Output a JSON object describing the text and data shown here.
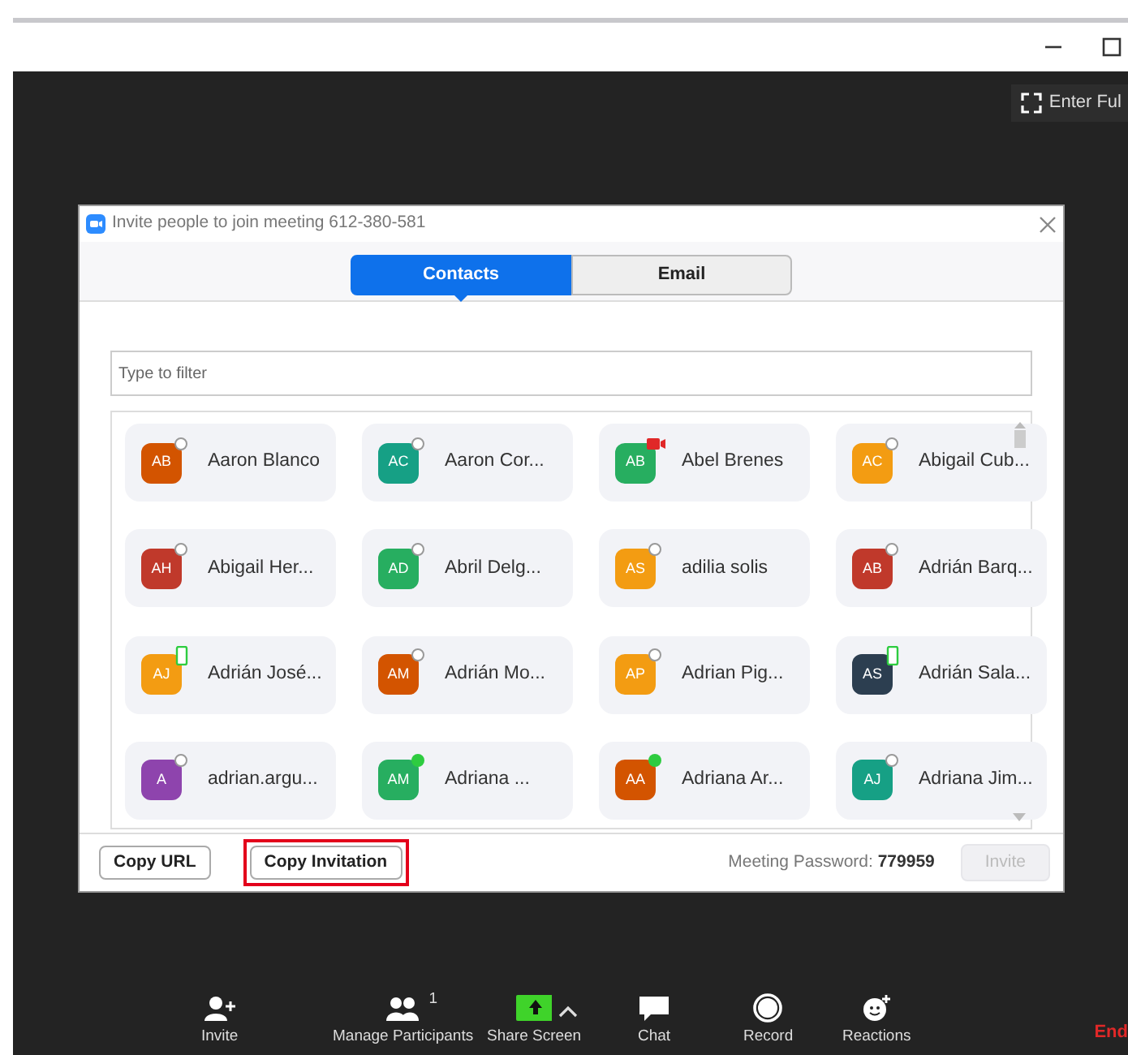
{
  "fullscreen_button": {
    "label": "Enter Ful"
  },
  "dialog": {
    "title": "Invite people to join meeting 612-380-581",
    "tabs": [
      {
        "label": "Contacts",
        "selected": true
      },
      {
        "label": "Email",
        "selected": false
      }
    ],
    "filter": {
      "placeholder": "Type to filter"
    },
    "contacts": [
      {
        "initials": "AB",
        "name": "Aaron Blanco",
        "color": "#d35400",
        "kind": "offline"
      },
      {
        "initials": "AC",
        "name": "Aaron Cor...",
        "color": "#16a085",
        "kind": "offline"
      },
      {
        "initials": "AB",
        "name": "Abel Brenes",
        "color": "#27ae60",
        "kind": "meeting"
      },
      {
        "initials": "AC",
        "name": "Abigail Cub...",
        "color": "#f39c12",
        "kind": "offline"
      },
      {
        "initials": "AH",
        "name": "Abigail Her...",
        "color": "#c0392b",
        "kind": "offline"
      },
      {
        "initials": "AD",
        "name": "Abril Delg...",
        "color": "#27ae60",
        "kind": "offline"
      },
      {
        "initials": "AS",
        "name": "adilia solis",
        "color": "#f39c12",
        "kind": "offline"
      },
      {
        "initials": "AB",
        "name": "Adrián Barq...",
        "color": "#c0392b",
        "kind": "offline"
      },
      {
        "initials": "AJ",
        "name": "Adrián José...",
        "color": "#f39c12",
        "kind": "phone"
      },
      {
        "initials": "AM",
        "name": "Adrián Mo...",
        "color": "#d35400",
        "kind": "offline"
      },
      {
        "initials": "AP",
        "name": "Adrian Pig...",
        "color": "#f39c12",
        "kind": "offline"
      },
      {
        "initials": "AS",
        "name": "Adrián Sala...",
        "color": "#2c3e50",
        "kind": "phone"
      },
      {
        "initials": "A",
        "name": "adrian.argu...",
        "color": "#8e44ad",
        "kind": "offline"
      },
      {
        "initials": "AM",
        "name": "Adriana ...",
        "color": "#27ae60",
        "kind": "online"
      },
      {
        "initials": "AA",
        "name": "Adriana Ar...",
        "color": "#d35400",
        "kind": "online"
      },
      {
        "initials": "AJ",
        "name": "Adriana Jim...",
        "color": "#16a085",
        "kind": "offline"
      }
    ],
    "buttons": [
      {
        "label": "Copy URL",
        "highlighted": false
      },
      {
        "label": "Copy Invitation",
        "highlighted": true
      }
    ],
    "password_label": "Meeting Password:",
    "password": "779959",
    "invite_button": {
      "label": "Invite",
      "disabled": true
    }
  },
  "toolbar": [
    {
      "kind": "invite",
      "label": "Invite"
    },
    {
      "kind": "participants",
      "label": "Manage Participants",
      "count": "1"
    },
    {
      "kind": "share",
      "label": "Share Screen"
    },
    {
      "kind": "caret"
    },
    {
      "kind": "chat",
      "label": "Chat"
    },
    {
      "kind": "record",
      "label": "Record"
    },
    {
      "kind": "reactions",
      "label": "Reactions"
    }
  ],
  "end_button": {
    "label": "End"
  }
}
